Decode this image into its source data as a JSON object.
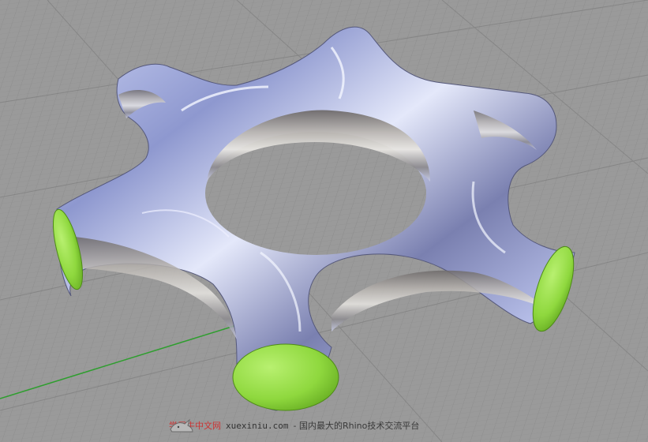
{
  "viewport": {
    "background_color": "#9a9a9a",
    "grid_minor_color": "#8e8e8e",
    "grid_major_color": "#7c7c7c",
    "x_axis_color": "#b33a3a",
    "y_axis_color": "#2e9e2e"
  },
  "model": {
    "surface_tint": "#9aa6d8",
    "cap_color": "#9be04a",
    "cap_shadow": "#5fa51d"
  },
  "watermark": {
    "brand": "学犀牛中文网",
    "url": "xuexiniu.com",
    "tagline": "- 国内最大的Rhino技术交流平台",
    "logo_icon": "rhino-logo-icon"
  }
}
